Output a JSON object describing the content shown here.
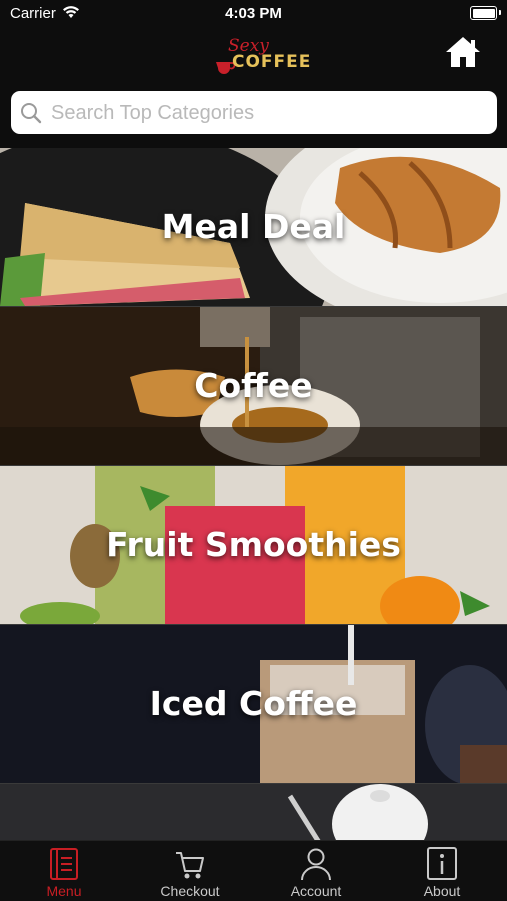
{
  "status_bar": {
    "carrier": "Carrier",
    "time": "4:03 PM"
  },
  "header": {
    "logo_script": "Sexy",
    "logo_word": "COFFEE"
  },
  "search": {
    "placeholder": "Search Top Categories",
    "value": ""
  },
  "categories": [
    {
      "label": "Meal Deal"
    },
    {
      "label": "Coffee"
    },
    {
      "label": "Fruit Smoothies"
    },
    {
      "label": "Iced Coffee"
    },
    {
      "label": ""
    }
  ],
  "tabs": [
    {
      "label": "Menu",
      "icon": "menu-book-icon",
      "active": true
    },
    {
      "label": "Checkout",
      "icon": "cart-icon",
      "active": false
    },
    {
      "label": "Account",
      "icon": "user-icon",
      "active": false
    },
    {
      "label": "About",
      "icon": "info-icon",
      "active": false
    }
  ],
  "colors": {
    "accent": "#c81e24",
    "logo_gold": "#e6c15a",
    "background": "#0d0d0d"
  }
}
